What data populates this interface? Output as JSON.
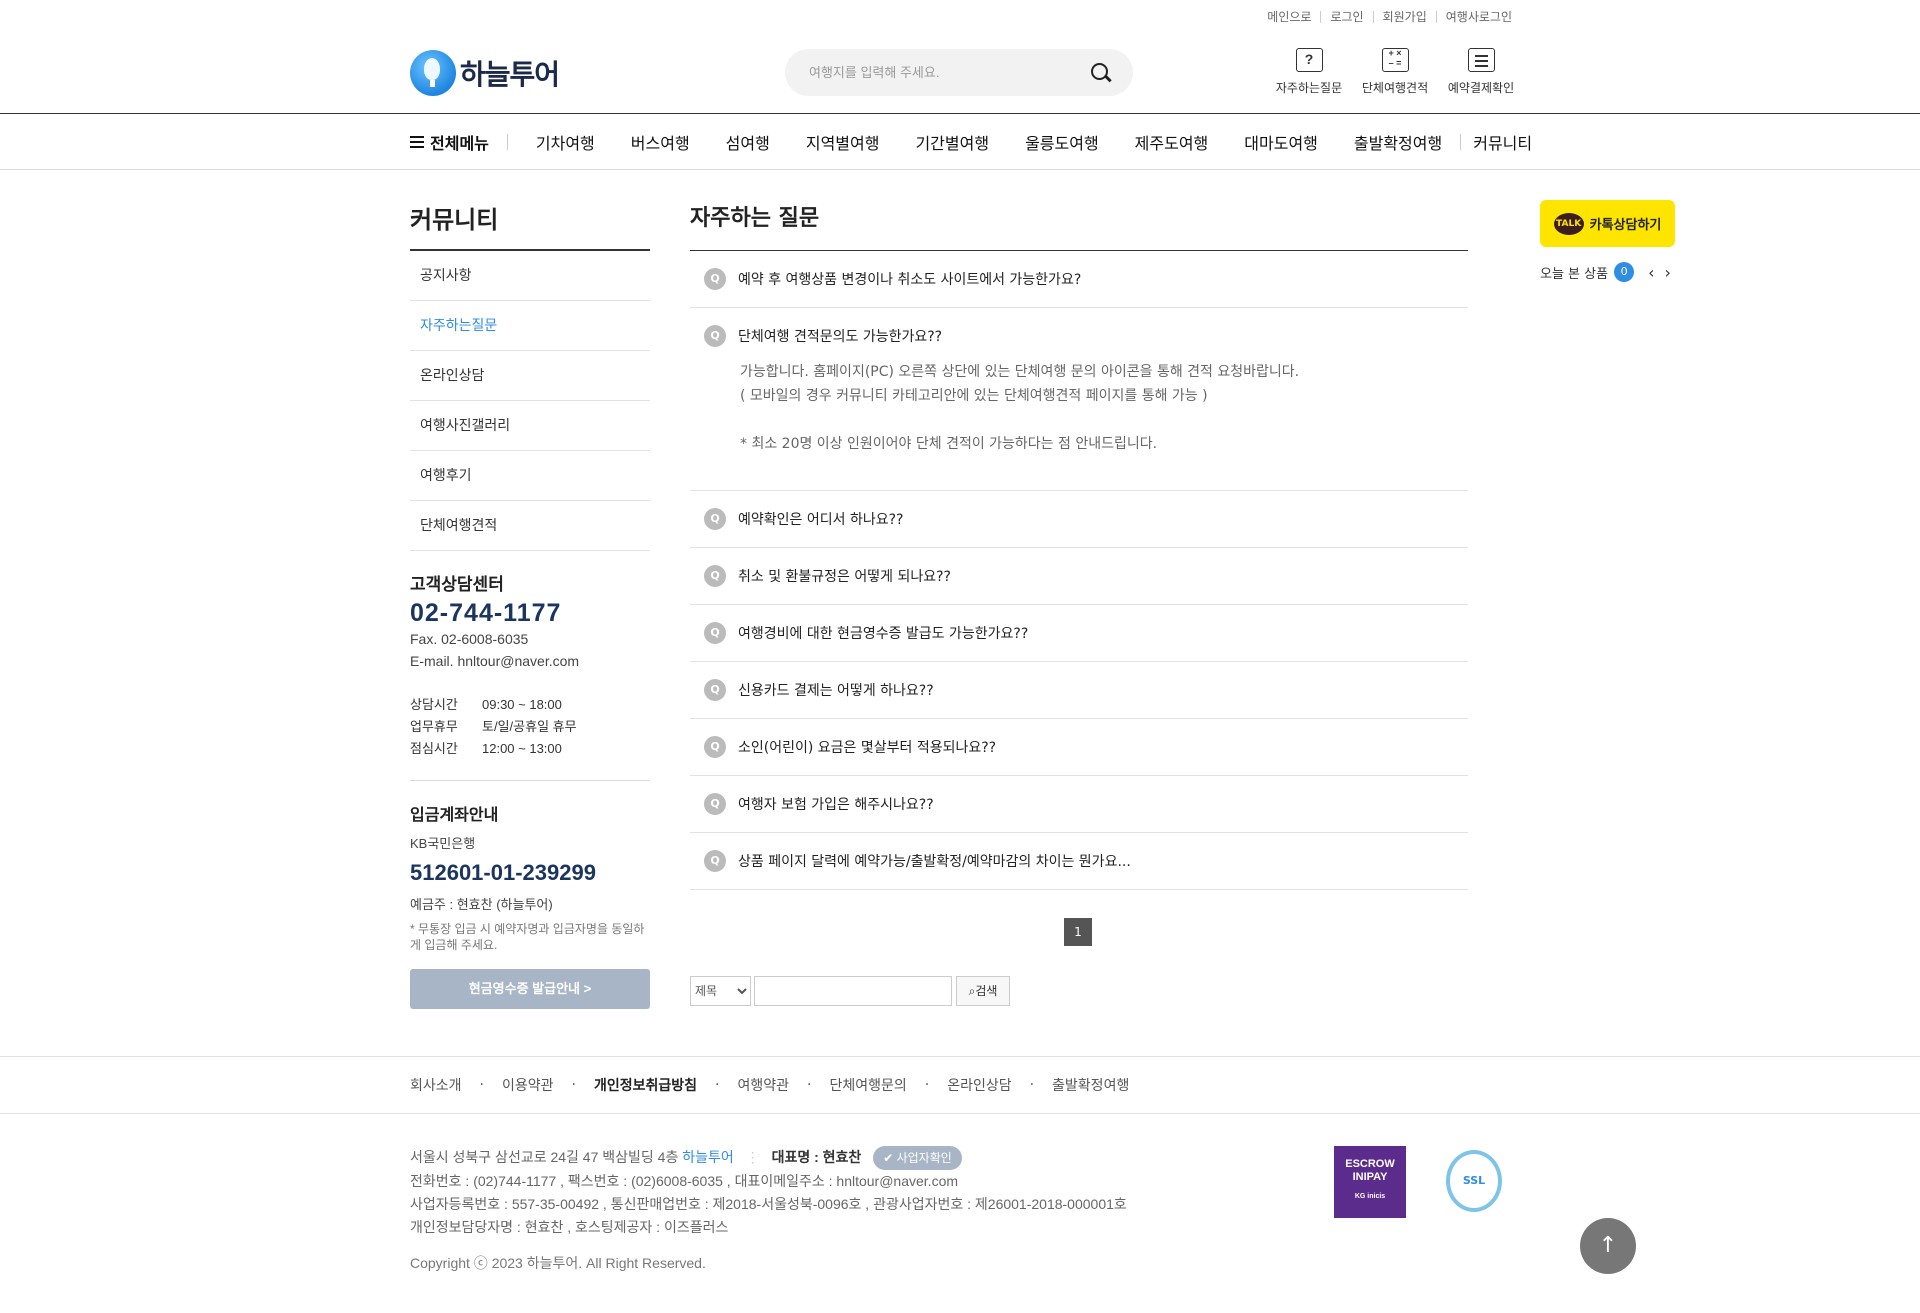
{
  "util_links": [
    "메인으로",
    "로그인",
    "회원가입",
    "여행사로그인"
  ],
  "logo": "하늘투어",
  "search": {
    "placeholder": "여행지를 입력해 주세요."
  },
  "quick_icons": [
    {
      "label": "자주하는질문",
      "icon": "question-icon"
    },
    {
      "label": "단체여행견적",
      "icon": "calculator-icon"
    },
    {
      "label": "예약결제확인",
      "icon": "document-icon"
    }
  ],
  "gnb": {
    "all_menu": "전체메뉴",
    "items": [
      "기차여행",
      "버스여행",
      "섬여행",
      "지역별여행",
      "기간별여행",
      "울릉도여행",
      "제주도여행",
      "대마도여행",
      "출발확정여행"
    ],
    "community": "커뮤니티"
  },
  "sidebar": {
    "title": "커뮤니티",
    "items": [
      "공지사항",
      "자주하는질문",
      "온라인상담",
      "여행사진갤러리",
      "여행후기",
      "단체여행견적"
    ],
    "active_index": 1
  },
  "customer_center": {
    "title": "고객상담센터",
    "tel": "02-744-1177",
    "fax": "Fax. 02-6008-6035",
    "email": "E-mail. hnltour@naver.com",
    "hours": [
      {
        "label": "상담시간",
        "value": "09:30 ~ 18:00"
      },
      {
        "label": "업무휴무",
        "value": "토/일/공휴일 휴무"
      },
      {
        "label": "점심시간",
        "value": "12:00 ~ 13:00"
      }
    ]
  },
  "bank": {
    "title": "입금계좌안내",
    "bank_name": "KB국민은행",
    "account": "512601-01-239299",
    "holder": "예금주 : 현효찬 (하늘투어)",
    "note": "* 무통장 입금 시 예약자명과 입금자명을 동일하게 입금해 주세요.",
    "receipt_button": "현금영수증 발급안내 >"
  },
  "main": {
    "title": "자주하는 질문",
    "badge": "Q",
    "faqs": [
      {
        "q": "예약 후 여행상품 변경이나 취소도 사이트에서 가능한가요?"
      },
      {
        "q": "단체여행 견적문의도 가능한가요??",
        "a": [
          "가능합니다. 홈페이지(PC) 오른쪽 상단에 있는 단체여행 문의 아이콘을 통해 견적 요청바랍니다.",
          "( 모바일의 경우 커뮤니티 카테고리안에 있는 단체여행견적 페이지를 통해 가능 )",
          "",
          "* 최소 20명 이상 인원이어야 단체 견적이 가능하다는 점 안내드립니다."
        ]
      },
      {
        "q": "예약확인은 어디서 하나요??"
      },
      {
        "q": "취소 및 환불규정은 어떻게 되나요??"
      },
      {
        "q": "여행경비에 대한 현금영수증 발급도 가능한가요??"
      },
      {
        "q": "신용카드 결제는 어떻게 하나요??"
      },
      {
        "q": "소인(어린이) 요금은 몇살부터 적용되나요??"
      },
      {
        "q": "여행자 보험 가입은 해주시나요??"
      },
      {
        "q": "상품 페이지 달력에 예약가능/출발확정/예약마감의 차이는 뭔가요..."
      }
    ],
    "page": "1",
    "search_field": "제목",
    "search_button": "검색"
  },
  "right": {
    "kakao_label": "카톡상담하기",
    "kakao_badge": "TALK",
    "today_label": "오늘 본 상품",
    "today_count": "0",
    "prev": "‹",
    "next": "›"
  },
  "footer": {
    "nav": [
      "회사소개",
      "이용약관",
      "개인정보취급방침",
      "여행약관",
      "단체여행문의",
      "온라인상담",
      "출발확정여행"
    ],
    "address": "서울시 성북구 삼선교로 24길 47 백삼빌딩 4층",
    "brand": "하늘투어",
    "ceo": "대표명 : 현효찬",
    "biz_check": "사업자확인",
    "line2": "전화번호 : (02)744-1177 , 팩스번호 : (02)6008-6035 , 대표이메일주소 : hnltour@naver.com",
    "line3": "사업자등록번호 : 557-35-00492 , 통신판매업번호 : 제2018-서울성북-0096호 , 관광사업자번호 : 제26001-2018-000001호",
    "line4": "개인정보담당자명 : 현효찬 , 호스팅제공자 : 이즈플러스",
    "copyright": "Copyright ⓒ 2023 하늘투어. All Right Reserved.",
    "escrow_line1": "ESCROW",
    "escrow_line2": "INIPAY",
    "escrow_sub": "KG inicis",
    "ssl": "SSL"
  },
  "colors": {
    "accent": "#2f8de4",
    "navy": "#1b3560",
    "kakao": "#fee500"
  }
}
